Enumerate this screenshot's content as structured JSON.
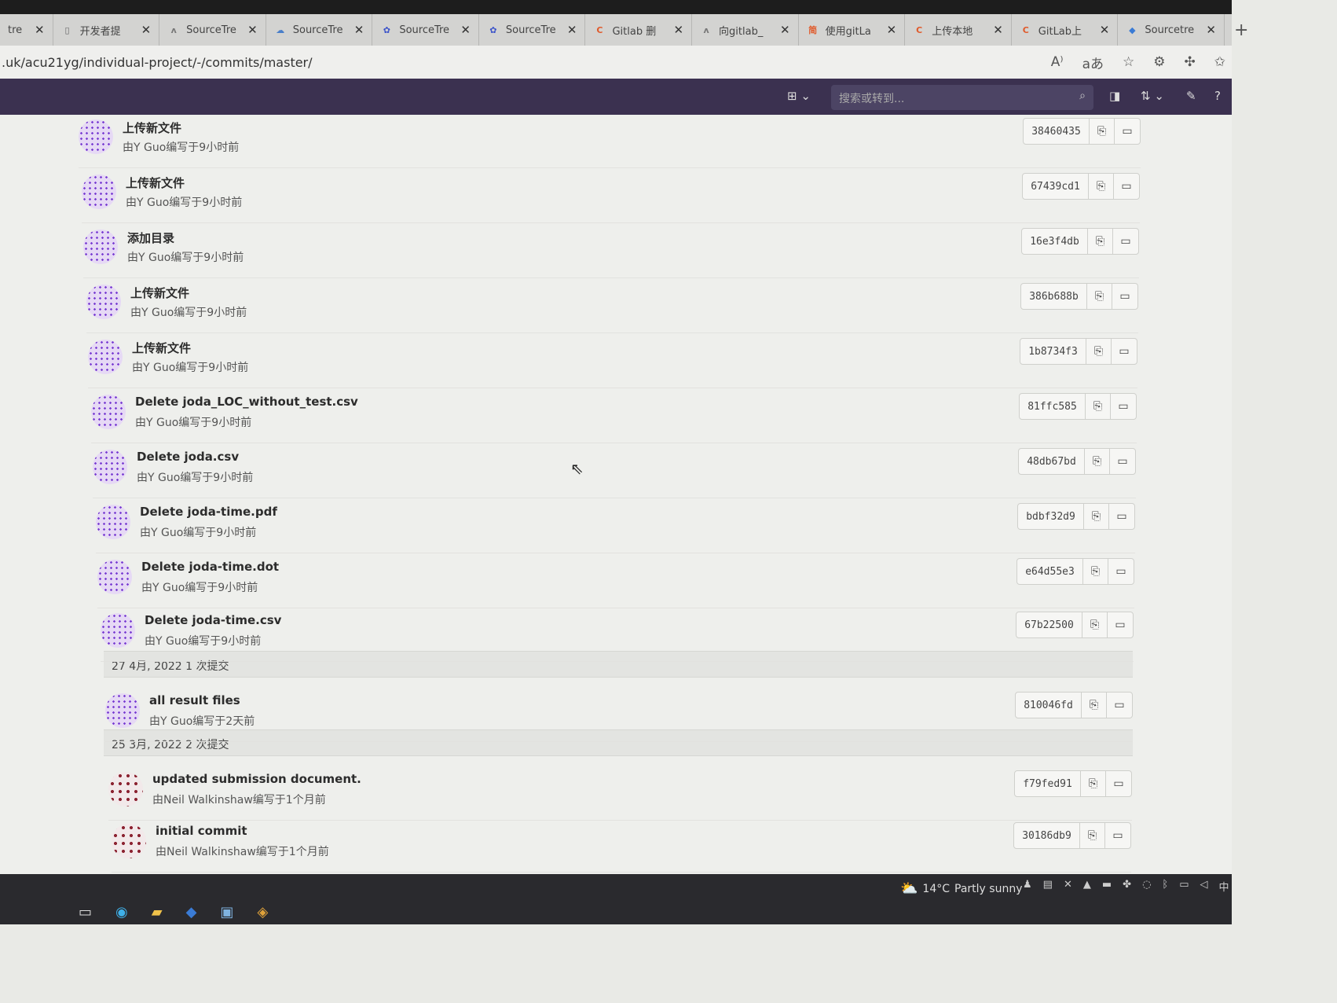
{
  "browser": {
    "tabs": [
      {
        "label": "tre",
        "icon": "page-icon",
        "icon_color": "#666"
      },
      {
        "label": "开发者提",
        "icon": "page-icon",
        "icon_color": "#666"
      },
      {
        "label": "SourceTre",
        "icon": "sourcetree-icon",
        "icon_color": "#777"
      },
      {
        "label": "SourceTre",
        "icon": "cloud-icon",
        "icon_color": "#4a7fc9"
      },
      {
        "label": "SourceTre",
        "icon": "paw-icon",
        "icon_color": "#3a52c9"
      },
      {
        "label": "SourceTre",
        "icon": "paw-icon",
        "icon_color": "#3a52c9"
      },
      {
        "label": "Gitlab 删",
        "icon": "csdn-icon",
        "icon_color": "#e05a2b"
      },
      {
        "label": "向gitlab_",
        "icon": "sourcetree-icon",
        "icon_color": "#777"
      },
      {
        "label": "使用gitLa",
        "icon": "jianshu-icon",
        "icon_color": "#e05a2b"
      },
      {
        "label": "上传本地",
        "icon": "csdn-icon",
        "icon_color": "#e05a2b"
      },
      {
        "label": "GitLab上",
        "icon": "csdn-icon",
        "icon_color": "#e05a2b"
      },
      {
        "label": "Sourcetre",
        "icon": "location-icon",
        "icon_color": "#3a7bd5"
      }
    ],
    "url": ".uk/acu21yg/individual-project/-/commits/master/"
  },
  "gitlab_header": {
    "search_placeholder": "搜索或转到..."
  },
  "commits": [
    {
      "message": "上传新文件",
      "meta": "由Y Guo编写于9小时前",
      "sha": "38460435",
      "avatar": "y"
    },
    {
      "message": "上传新文件",
      "meta": "由Y Guo编写于9小时前",
      "sha": "67439cd1",
      "avatar": "y"
    },
    {
      "message": "添加目录",
      "meta": "由Y Guo编写于9小时前",
      "sha": "16e3f4db",
      "avatar": "y"
    },
    {
      "message": "上传新文件",
      "meta": "由Y Guo编写于9小时前",
      "sha": "386b688b",
      "avatar": "y"
    },
    {
      "message": "上传新文件",
      "meta": "由Y Guo编写于9小时前",
      "sha": "1b8734f3",
      "avatar": "y"
    },
    {
      "message": "Delete joda_LOC_without_test.csv",
      "meta": "由Y Guo编写于9小时前",
      "sha": "81ffc585",
      "avatar": "y"
    },
    {
      "message": "Delete joda.csv",
      "meta": "由Y Guo编写于9小时前",
      "sha": "48db67bd",
      "avatar": "y"
    },
    {
      "message": "Delete joda-time.pdf",
      "meta": "由Y Guo编写于9小时前",
      "sha": "bdbf32d9",
      "avatar": "y"
    },
    {
      "message": "Delete joda-time.dot",
      "meta": "由Y Guo编写于9小时前",
      "sha": "e64d55e3",
      "avatar": "y"
    },
    {
      "message": "Delete joda-time.csv",
      "meta": "由Y Guo编写于9小时前",
      "sha": "67b22500",
      "avatar": "y"
    },
    {
      "message": "all result files",
      "meta": "由Y Guo编写于2天前",
      "sha": "810046fd",
      "avatar": "y"
    },
    {
      "message": "updated submission document.",
      "meta": "由Neil Walkinshaw编写于1个月前",
      "sha": "f79fed91",
      "avatar": "neil"
    },
    {
      "message": "initial commit",
      "meta": "由Neil Walkinshaw编写于1个月前",
      "sha": "30186db9",
      "avatar": "neil"
    }
  ],
  "day_headers": [
    {
      "label": "27 4月, 2022 1 次提交"
    },
    {
      "label": "25 3月, 2022 2 次提交"
    }
  ],
  "taskbar": {
    "temperature": "14°C",
    "weather": "Partly sunny",
    "ime": "中"
  }
}
